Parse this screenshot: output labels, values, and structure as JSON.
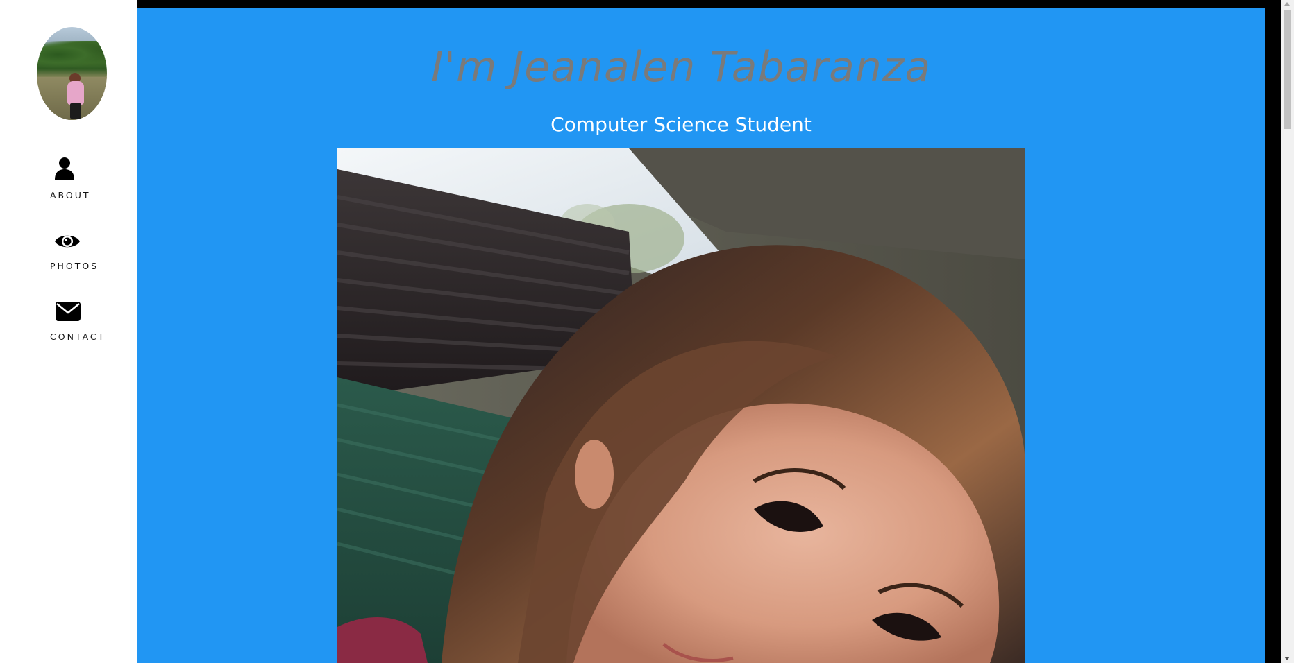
{
  "sidebar": {
    "avatar_alt": "profile photo",
    "items": [
      {
        "label": "ABOUT",
        "icon": "user-icon"
      },
      {
        "label": "PHOTOS",
        "icon": "eye-icon"
      },
      {
        "label": "CONTACT",
        "icon": "envelope-icon"
      }
    ]
  },
  "hero": {
    "title": "I'm Jeanalen Tabaranza",
    "subtitle": "Computer Science Student"
  },
  "colors": {
    "main_background": "#2196f3",
    "title_color": "#7a7a7a",
    "subtitle_color": "#ffffff",
    "sidebar_background": "#ffffff"
  }
}
